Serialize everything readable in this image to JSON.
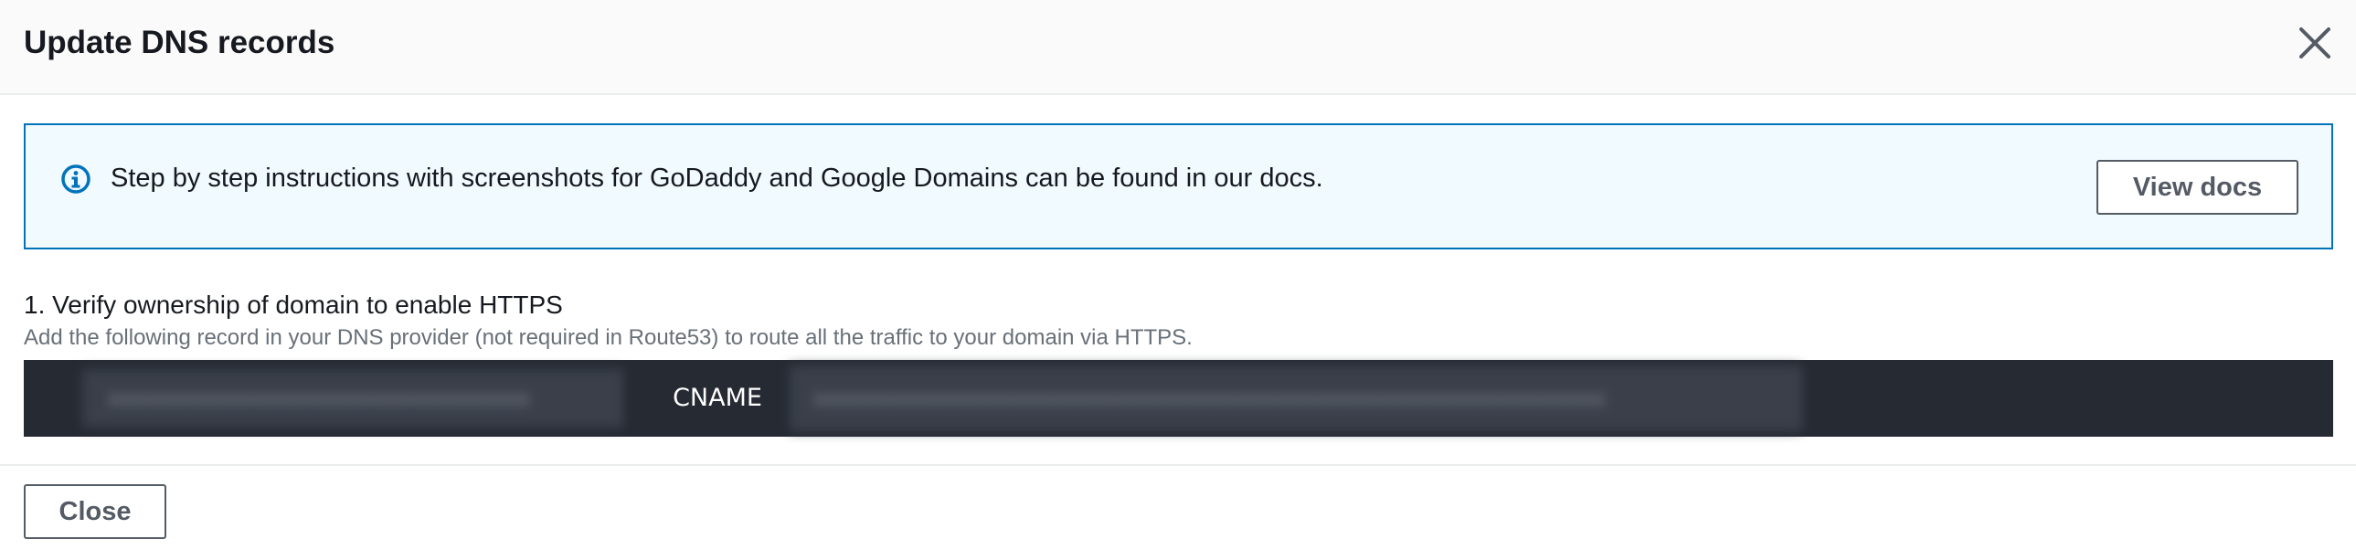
{
  "modal": {
    "title": "Update DNS records",
    "close_icon": "close-icon"
  },
  "info_alert": {
    "icon": "info-icon",
    "text": "Step by step instructions with screenshots for GoDaddy and Google Domains can be found in our docs.",
    "view_docs_label": "View docs"
  },
  "step1": {
    "heading": "1. Verify ownership of domain to enable HTTPS",
    "description": "Add the following record in your DNS provider (not required in Route53) to route all the traffic to your domain via HTTPS."
  },
  "record": {
    "type": "CNAME"
  },
  "footer": {
    "close_label": "Close"
  },
  "colors": {
    "accent": "#0073bb",
    "alert_bg": "#f1faff",
    "record_bar_bg": "#262a33",
    "button_border": "#545b64"
  }
}
